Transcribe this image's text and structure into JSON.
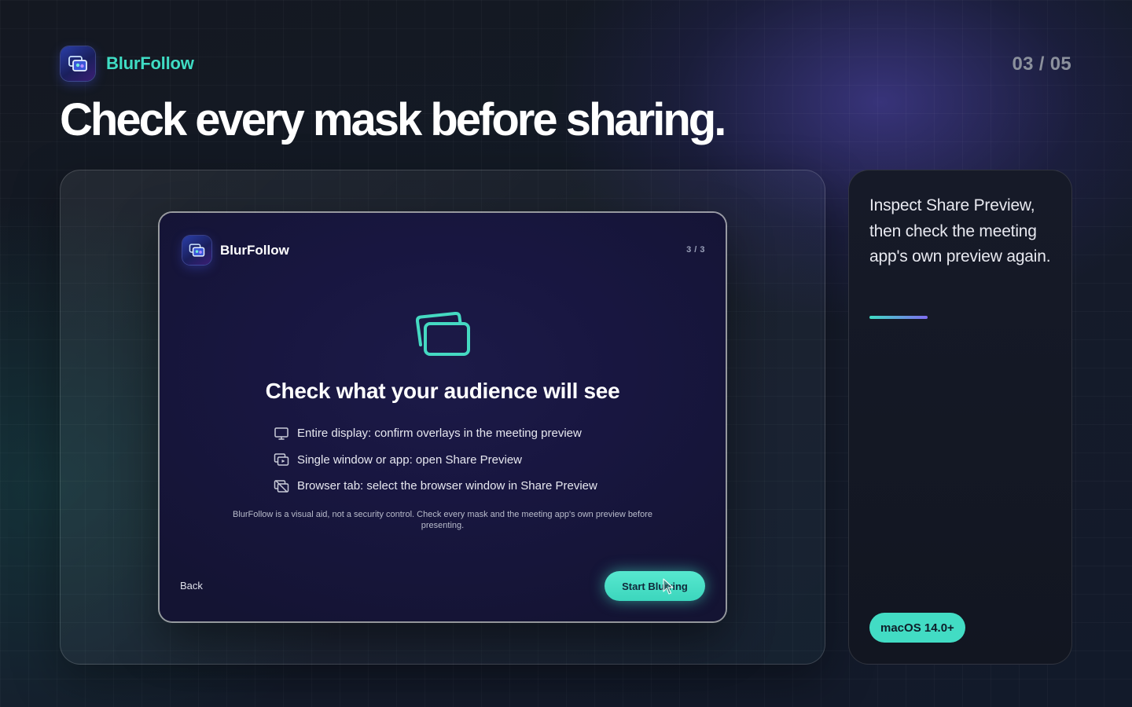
{
  "header": {
    "brand_name": "BlurFollow",
    "page_counter": "03 / 05",
    "headline": "Check every mask before sharing."
  },
  "app_window": {
    "brand_name": "BlurFollow",
    "step": "3 / 3",
    "title": "Check what your audience will see",
    "checklist": [
      {
        "icon": "display-icon",
        "text": "Entire display: confirm overlays in the meeting preview"
      },
      {
        "icon": "window-share-icon",
        "text": "Single window or app: open Share Preview"
      },
      {
        "icon": "browser-tab-icon",
        "text": "Browser tab: select the browser window in Share Preview"
      }
    ],
    "disclaimer": "BlurFollow is a visual aid, not a security control. Check every mask and the meeting app's own preview before presenting.",
    "back_label": "Back",
    "start_label": "Start Blurring"
  },
  "side_panel": {
    "text": "Inspect Share Preview, then check the meeting app's own preview again.",
    "badge": "macOS 14.0+"
  },
  "colors": {
    "accent": "#3fdcc4",
    "accent_secondary": "#7f6bf0",
    "window_bg": "#181640",
    "counter": "#8b909c"
  }
}
